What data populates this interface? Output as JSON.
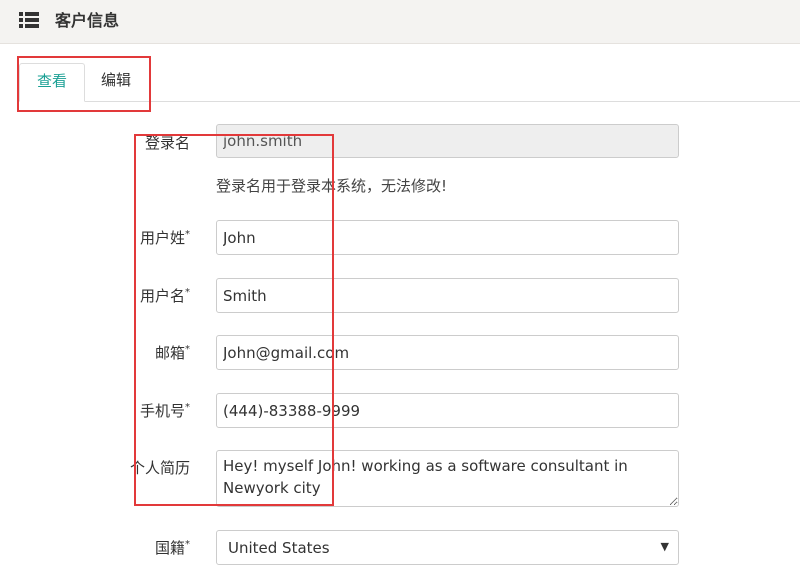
{
  "header": {
    "title": "客户信息",
    "icon": "list-icon"
  },
  "tabs": [
    {
      "label": "查看",
      "active": true
    },
    {
      "label": "编辑",
      "active": false
    }
  ],
  "form": {
    "login": {
      "label": "登录名",
      "value": "john.smith",
      "help": "登录名用于登录本系统，无法修改!"
    },
    "last_name": {
      "label": "用户姓",
      "required": "*",
      "value": "John"
    },
    "first_name": {
      "label": "用户名",
      "required": "*",
      "value": "Smith"
    },
    "email": {
      "label": "邮箱",
      "required": "*",
      "value": "John@gmail.com"
    },
    "phone": {
      "label": "手机号",
      "required": "*",
      "value": "(444)-83388-9999"
    },
    "bio": {
      "label": "个人简历",
      "value": "Hey! myself John! working as a software consultant in Newyork city"
    },
    "nationality": {
      "label": "国籍",
      "required": "*",
      "value": "United States",
      "arrow": "▼"
    }
  },
  "colors": {
    "accent": "#1aa094",
    "highlight_box": "#e2393a",
    "header_bg": "#f4f3f1",
    "readonly_bg": "#eeeeee"
  }
}
